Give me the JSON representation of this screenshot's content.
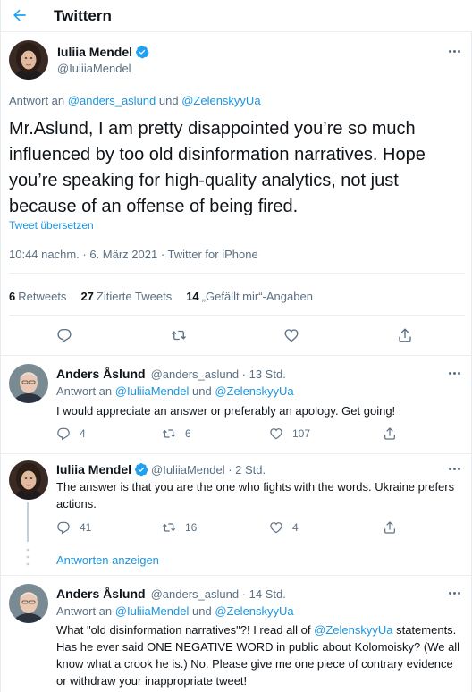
{
  "header": {
    "title": "Twittern",
    "back_icon": "arrow-left-icon"
  },
  "main_tweet": {
    "author_name": "Iuliia Mendel",
    "handle": "@IuliiaMendel",
    "reply_prefix": "Antwort an",
    "reply_mention_1": "@anders_aslund",
    "reply_and": "und",
    "reply_mention_2": "@ZelenskyyUa",
    "text": "Mr.Aslund, I am pretty disappointed you’re so much influenced by too old disinformation narratives. Hope you’re speaking for high-quality analytics, not just because of an offense of being fired.",
    "translate": "Tweet übersetzen",
    "meta": "10:44 nachm. · 6. März 2021 · Twitter for iPhone",
    "stats": {
      "retweets_count": "6",
      "retweets_label": "Retweets",
      "quotes_count": "27",
      "quotes_label": "Zitierte Tweets",
      "likes_count": "14",
      "likes_label": "„Gefällt mir“-Angaben"
    }
  },
  "replies": [
    {
      "author_name": "Anders Åslund",
      "meta": "@anders_aslund · 13 Std.",
      "reply_prefix": "Antwort an",
      "reply_mention_1": "@IuliiaMendel",
      "reply_and": "und",
      "reply_mention_2": "@ZelenskyyUa",
      "text": "I would appreciate an answer or preferably an apology. Get going!",
      "reply_count": "4",
      "retweet_count": "6",
      "like_count": "107"
    },
    {
      "author_name": "Iuliia Mendel",
      "meta": "@IuliiaMendel · 2 Std.",
      "text": "The answer is that you are the one who fights with the words. Ukraine prefers actions.",
      "reply_count": "41",
      "retweet_count": "16",
      "like_count": "4"
    },
    {
      "author_name": "Anders Åslund",
      "meta": "@anders_aslund · 14 Std.",
      "reply_prefix": "Antwort an",
      "reply_mention_1": "@IuliiaMendel",
      "reply_and": "und",
      "reply_mention_2": "@ZelenskyyUa",
      "text_part_1": "What \"old disinformation narratives\"?! I read all of ",
      "text_mention": "@ZelenskyyUa",
      "text_part_2": " statements. Has he ever said ONE NEGATIVE WORD in public about Kolomoisky? (We all know what a crook he is.) No. Please give me one piece of contrary evidence or withdraw your inappropriate tweet!"
    }
  ],
  "show_replies": "Antworten anzeigen",
  "colors": {
    "accent": "#1b95e0",
    "secondary_text": "#5b7083",
    "verified": "#1da1f2"
  }
}
